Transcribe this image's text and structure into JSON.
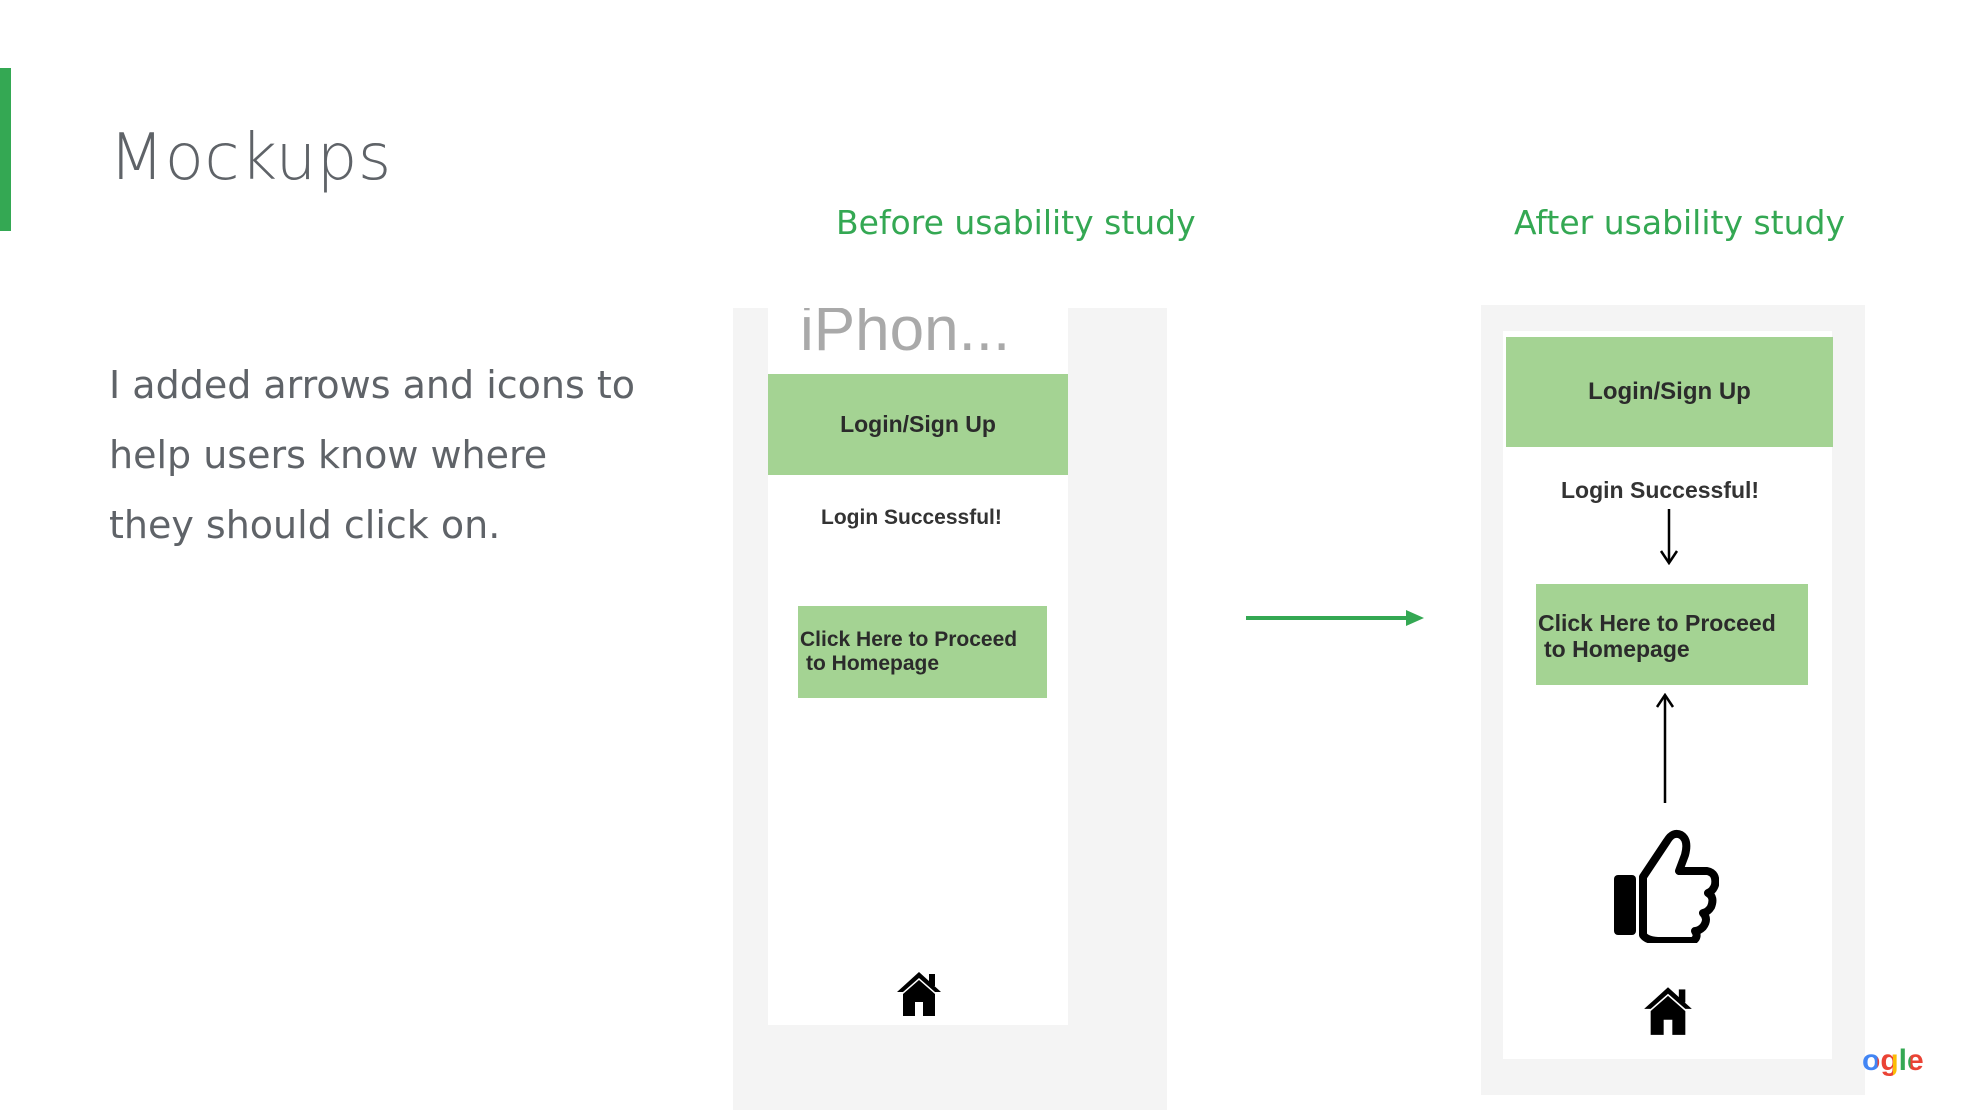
{
  "slide": {
    "title": "Mockups",
    "body_lines": [
      "I added arrows and icons to",
      "help users know where",
      "they should click on."
    ],
    "accent_color": "#34a853"
  },
  "before": {
    "label": "Before usability study",
    "device_label": "iPhon...",
    "header_button": "Login/Sign Up",
    "status": "Login Successful!",
    "proceed_line1": "Click Here to Proceed",
    "proceed_line2": "to Homepage",
    "icons": [
      "home-icon"
    ]
  },
  "after": {
    "label": "After usability study",
    "header_button": "Login/Sign Up",
    "status": "Login Successful!",
    "proceed_line1": "Click Here to Proceed",
    "proceed_line2": "to Homepage",
    "icons": [
      "arrow-down-icon",
      "arrow-up-icon",
      "thumbs-up-icon",
      "home-icon"
    ]
  },
  "transition": {
    "icon": "arrow-right-icon",
    "color": "#34a853"
  },
  "logo": {
    "text": "ogle"
  }
}
